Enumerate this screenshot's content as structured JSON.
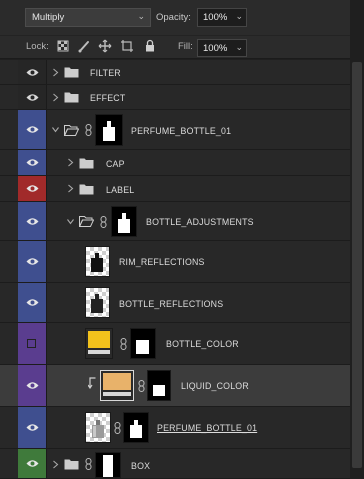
{
  "blend_mode": {
    "value": "Multiply"
  },
  "opacity": {
    "label": "Opacity:",
    "value": "100%"
  },
  "lock": {
    "label": "Lock:",
    "icons": [
      "lock-transparent-pixels-icon",
      "lock-image-pixels-icon",
      "lock-position-icon",
      "prevent-auto-nesting-icon",
      "lock-all-icon"
    ]
  },
  "fill": {
    "label": "Fill:",
    "value": "100%"
  },
  "colors": {
    "label_blue": "#3f4f8f",
    "label_red": "#a12a2a",
    "label_purple": "#5a3d8f",
    "label_green": "#3f7a3b",
    "bottle_color_swatch": "#f2c21c",
    "liquid_color_swatch": "#e8b26a"
  },
  "layers": [
    {
      "name": "FILTER",
      "type": "group"
    },
    {
      "name": "EFFECT",
      "type": "group"
    },
    {
      "name": "PERFUME_BOTTLE_01",
      "type": "group-masked",
      "expanded": true,
      "label_color": "blue"
    },
    {
      "name": "CAP",
      "type": "group",
      "label_color": "blue"
    },
    {
      "name": "LABEL",
      "type": "group",
      "label_color": "red"
    },
    {
      "name": "BOTTLE_ADJUSTMENTS",
      "type": "group-masked",
      "expanded": true,
      "label_color": "blue"
    },
    {
      "name": "RIM_REFLECTIONS",
      "type": "pixel",
      "label_color": "blue"
    },
    {
      "name": "BOTTLE_REFLECTIONS",
      "type": "pixel",
      "label_color": "blue"
    },
    {
      "name": "BOTTLE_COLOR",
      "type": "fill-masked",
      "visible": false,
      "label_color": "purple"
    },
    {
      "name": "LIQUID_COLOR",
      "type": "fill-masked",
      "clipped": true,
      "selected": true,
      "label_color": "purple"
    },
    {
      "name": "PERFUME_BOTTLE_01",
      "type": "smart-masked",
      "label_color": "blue"
    },
    {
      "name": "BOX",
      "type": "group-masked",
      "label_color": "green"
    }
  ]
}
